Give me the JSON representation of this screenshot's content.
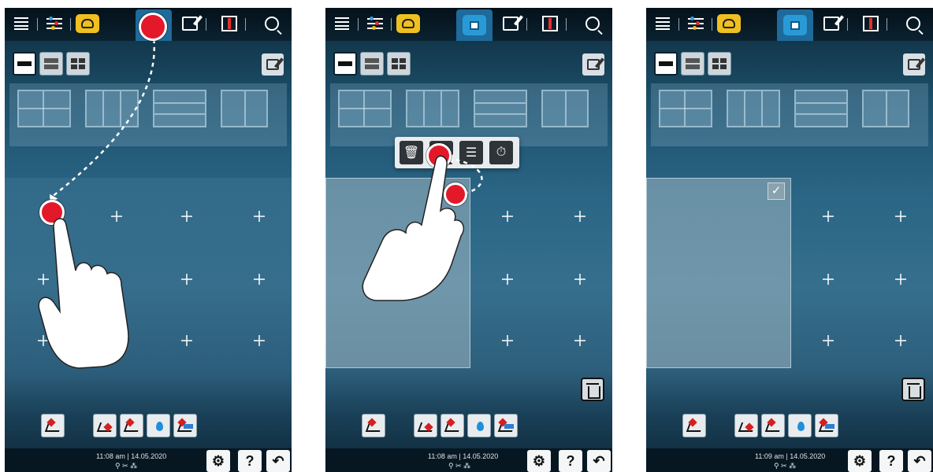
{
  "panels": [
    {
      "id": "panel-1",
      "topbar_icons": [
        "menu-icon",
        "adjust-icon",
        "chef-hat-icon",
        "planning-icon",
        "edit-icon",
        "temperature-icon",
        "search-icon"
      ],
      "active_tab": "planning",
      "layout_tabs": [
        "single-row",
        "two-rows",
        "four-grid"
      ],
      "selected_layout": "single-row",
      "status": {
        "time": "11:08 am",
        "date": "14.05.2020"
      },
      "state": "tap-slot"
    },
    {
      "id": "panel-2",
      "topbar_icons": [
        "menu-icon",
        "adjust-icon",
        "chef-hat-icon",
        "planning-icon",
        "edit-icon",
        "temperature-icon",
        "search-icon"
      ],
      "active_tab": "planning",
      "layout_tabs": [
        "single-row",
        "two-rows",
        "four-grid"
      ],
      "selected_layout": "single-row",
      "status": {
        "time": "11:08 am",
        "date": "14.05.2020"
      },
      "popup_icons": [
        "trash-icon",
        "move-icon",
        "adjust-icon",
        "timer-icon"
      ],
      "state": "context-menu"
    },
    {
      "id": "panel-3",
      "topbar_icons": [
        "menu-icon",
        "adjust-icon",
        "chef-hat-icon",
        "planning-icon",
        "edit-icon",
        "temperature-icon",
        "search-icon"
      ],
      "active_tab": "planning",
      "layout_tabs": [
        "single-row",
        "two-rows",
        "four-grid"
      ],
      "selected_layout": "single-row",
      "status": {
        "time": "11:09 am",
        "date": "14.05.2020"
      },
      "state": "selected"
    }
  ],
  "status_labels": {
    "p1_time": "11:08 am",
    "p1_date": "14.05.2020",
    "p2_time": "11:08 am",
    "p2_date": "14.05.2020",
    "p3_time": "11:09 am",
    "p3_date": "14.05.2020",
    "separator": "|",
    "help": "?",
    "check": "✓"
  },
  "colors": {
    "accent_blue": "#2a9ad6",
    "chef_yellow": "#f0c020",
    "touch_red": "#e3192a",
    "panel_dark": "#0d2a3b"
  }
}
